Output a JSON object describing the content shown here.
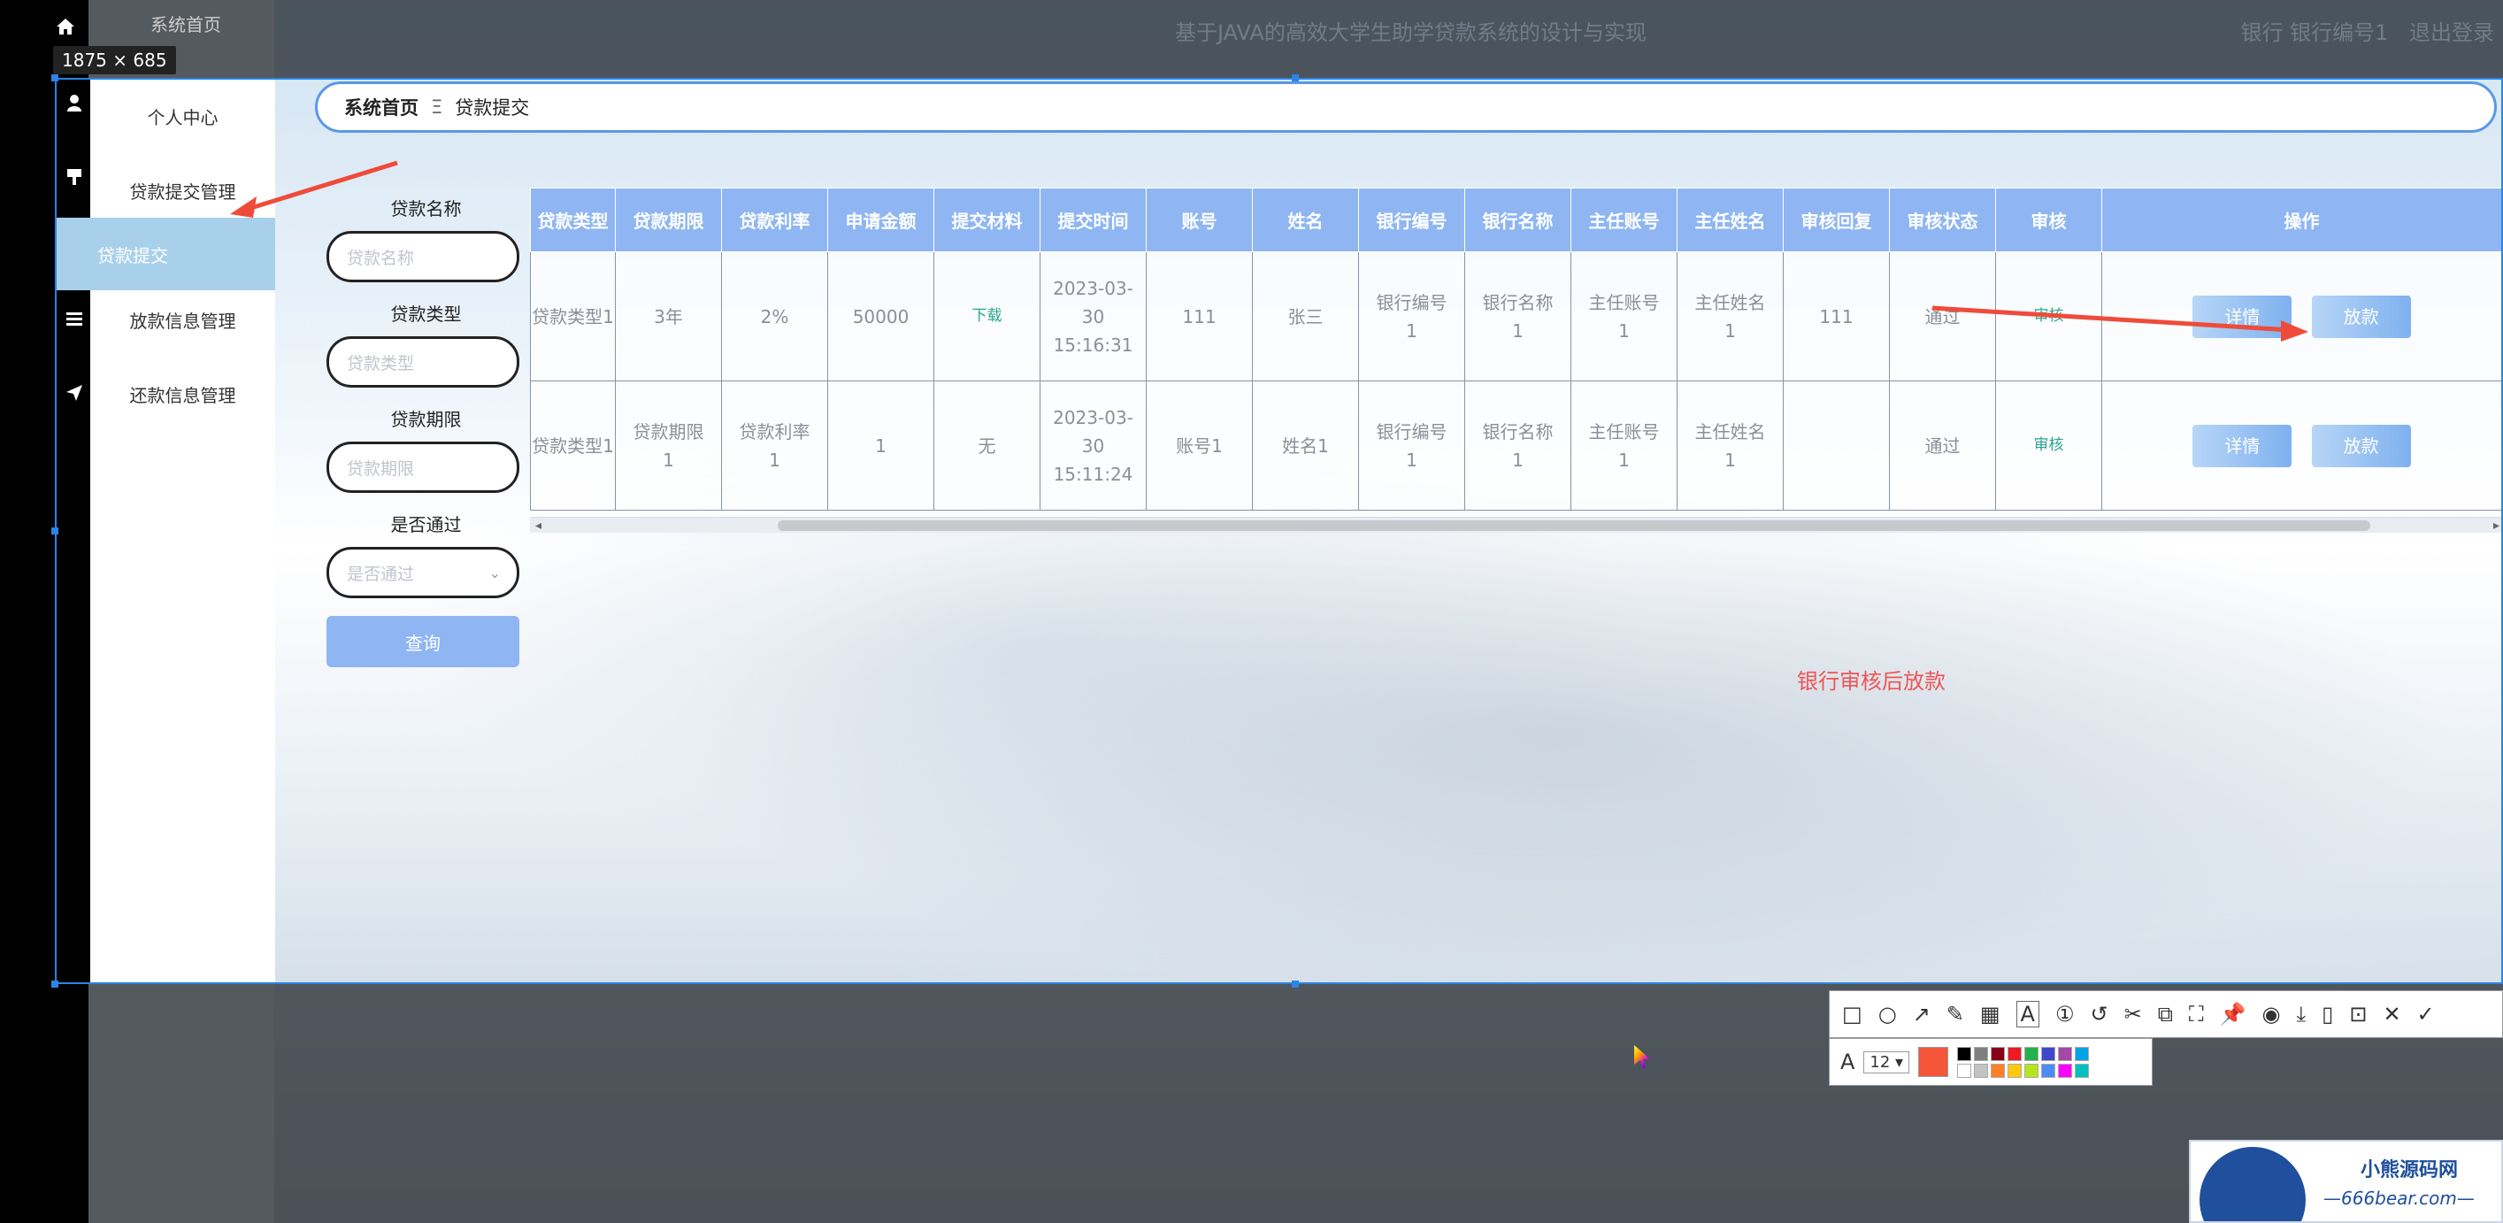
{
  "window": {
    "title": "基于JAVA的高效大学生助学贷款系统的设计与实现",
    "user": "银行 银行编号1",
    "logout": "退出登录",
    "dimension_label": "1875 × 685"
  },
  "sidebar": {
    "items": [
      {
        "label": "系统首页",
        "icon": "home-icon"
      },
      {
        "label": "个人中心",
        "icon": "user-icon"
      },
      {
        "label": "贷款提交管理",
        "icon": "brush-icon"
      },
      {
        "label": "贷款提交",
        "icon": "",
        "active": true
      },
      {
        "label": "放款信息管理",
        "icon": "list-icon"
      },
      {
        "label": "还款信息管理",
        "icon": "send-icon"
      }
    ]
  },
  "breadcrumb": {
    "root": "系统首页",
    "sep": "Ξ",
    "current": "贷款提交"
  },
  "filters": {
    "fields": [
      {
        "label": "贷款名称",
        "placeholder": "贷款名称"
      },
      {
        "label": "贷款类型",
        "placeholder": "贷款类型"
      },
      {
        "label": "贷款期限",
        "placeholder": "贷款期限"
      },
      {
        "label": "是否通过",
        "placeholder": "是否通过"
      }
    ],
    "query_button": "查询"
  },
  "table": {
    "headers": [
      "贷款类型",
      "贷款期限",
      "贷款利率",
      "申请金额",
      "提交材料",
      "提交时间",
      "账号",
      "姓名",
      "银行编号",
      "银行名称",
      "主任账号",
      "主任姓名",
      "审核回复",
      "审核状态",
      "审核",
      "操作"
    ],
    "rows": [
      {
        "cells": [
          "贷款类型1",
          "3年",
          "2%",
          "50000",
          "下载",
          "2023-03-30 15:16:31",
          "111",
          "张三",
          "银行编号1",
          "银行名称1",
          "主任账号1",
          "主任姓名1",
          "111",
          "通过",
          "审核"
        ],
        "detail": "详情",
        "disburse": "放款"
      },
      {
        "cells": [
          "贷款类型1",
          "贷款期限1",
          "贷款利率1",
          "1",
          "无",
          "2023-03-30 15:11:24",
          "账号1",
          "姓名1",
          "银行编号1",
          "银行名称1",
          "主任账号1",
          "主任姓名1",
          "",
          "通过",
          "审核"
        ],
        "detail": "详情",
        "disburse": "放款"
      }
    ]
  },
  "annotation": "银行审核后放款",
  "toolbar": {
    "font_size": "12",
    "colors": [
      "#000000",
      "#7f7f7f",
      "#880015",
      "#ed1c24",
      "#22b14c",
      "#3f48cc",
      "#a349a4",
      "#00a2e8",
      "#ffffff",
      "#c3c3c3",
      "#ff7f27",
      "#ffc90e",
      "#b5e61d",
      "#4b8bf5",
      "#f0f",
      "#00c0c0"
    ],
    "active_color": "#f5563a"
  },
  "logo": {
    "line1": "小熊源码网",
    "line2": "—666bear.com—"
  }
}
